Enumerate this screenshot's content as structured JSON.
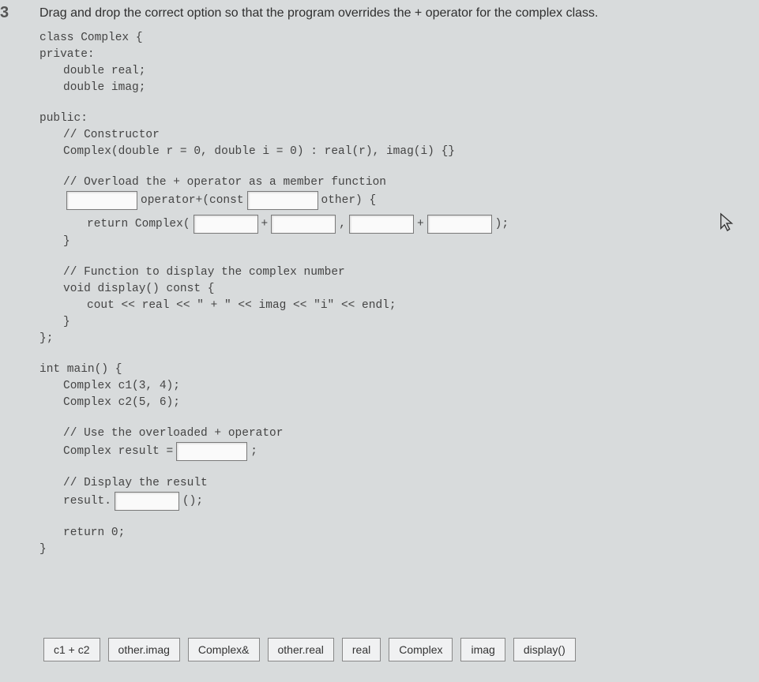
{
  "question_number": "3",
  "prompt": "Drag and drop the correct option so that the program overrides the + operator for the complex class.",
  "code": {
    "l01": "class Complex {",
    "l02": "private:",
    "l03": "double real;",
    "l04": "double imag;",
    "l05": "public:",
    "l06": "// Constructor",
    "l07": "Complex(double r = 0, double i = 0) : real(r), imag(i) {}",
    "l08": "// Overload the + operator as a member function",
    "l09a": " operator+(const ",
    "l09b": " other) {",
    "l10a": "return Complex(",
    "l10b": " + ",
    "l10c": " , ",
    "l10d": " + ",
    "l10e": " );",
    "l11": "}",
    "l12": "// Function to display the complex number",
    "l13": "void display() const {",
    "l14": "cout << real << \" + \" << imag << \"i\" << endl;",
    "l15": "}",
    "l16": "};",
    "l17": "int main() {",
    "l18": "Complex c1(3, 4);",
    "l19": "Complex c2(5, 6);",
    "l20": "// Use the overloaded + operator",
    "l21a": "Complex result = ",
    "l21b": " ;",
    "l22": "// Display the result",
    "l23a": "result.",
    "l23b": " ();",
    "l24": "return 0;",
    "l25": "}"
  },
  "options": [
    "c1 + c2",
    "other.imag",
    "Complex&",
    "other.real",
    "real",
    "Complex",
    "imag",
    "display()"
  ]
}
